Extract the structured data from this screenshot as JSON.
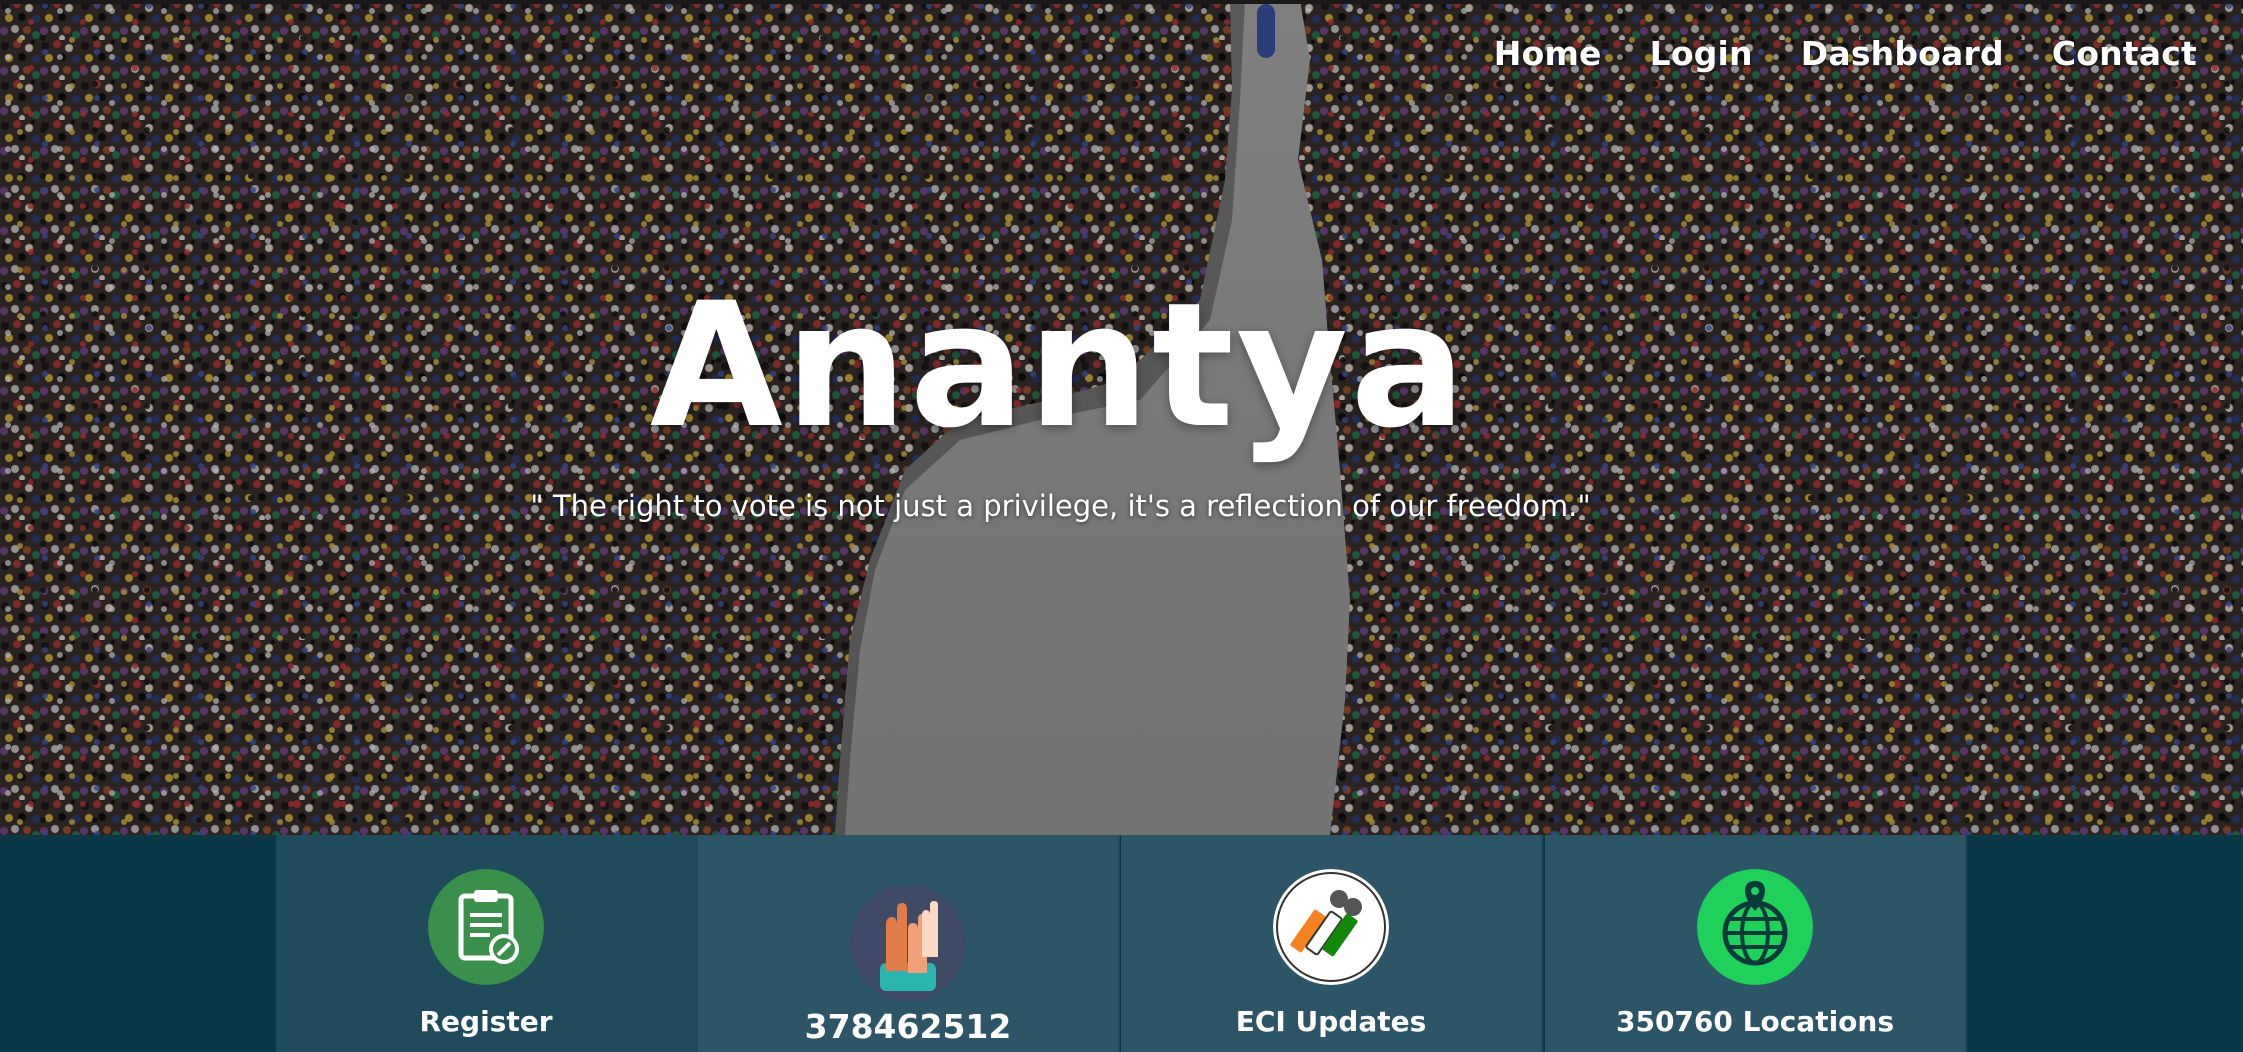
{
  "nav": {
    "items": [
      "Home",
      "Login",
      "Dashboard",
      "Contact"
    ]
  },
  "hero": {
    "title": "Anantya",
    "quote": "\" The right to vote is not just a privilege, it's a reflection of our freedom.\""
  },
  "stats": [
    {
      "label": "Register",
      "icon": "clipboard-icon"
    },
    {
      "label": "378462512",
      "icon": "raised-hands-icon"
    },
    {
      "label": "ECI Updates",
      "icon": "eci-logo-icon"
    },
    {
      "label": "350760 Locations",
      "icon": "globe-pin-icon"
    }
  ],
  "colors": {
    "stats_bg": "#0a3745",
    "card_bg": "#2c5567",
    "register_icon": "#3a8f4a",
    "globe_icon": "#1fd05a"
  }
}
